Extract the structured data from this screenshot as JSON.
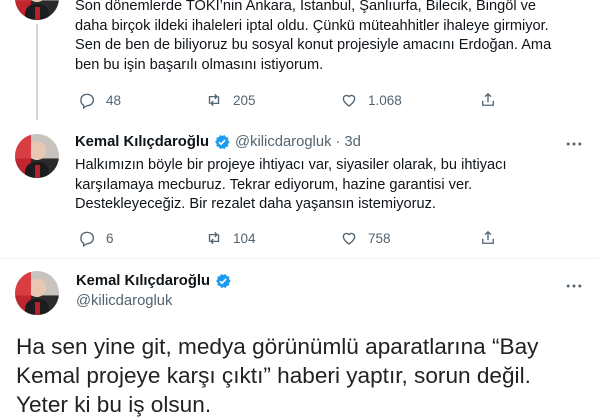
{
  "tweet1": {
    "text_lines": [
      "Son dönemlerde TOKİ’nin Ankara, İstanbul, Şanlıurfa, Bilecik, Bingöl ve",
      "daha birçok ildeki ihaleleri iptal oldu. Çünkü müteahhitler ihaleye girmiyor.",
      "Sen de ben de biliyoruz bu sosyal konut projesiyle amacını Erdoğan. Ama",
      "ben bu işin başarılı olmasını istiyorum."
    ],
    "replies": "48",
    "retweets": "205",
    "likes": "1.068"
  },
  "tweet2": {
    "name": "Kemal Kılıçdaroğlu",
    "handle": "@kilicdarogluk",
    "separator": "·",
    "time": "3d",
    "text_lines": [
      "Halkımızın böyle bir projeye ihtiyacı var, siyasiler olarak, bu ihtiyacı",
      "karşılamaya mecburuz. Tekrar ediyorum, hazine garantisi ver.",
      "Destekleyeceğiz. Bir rezalet daha yaşansın istemiyoruz."
    ],
    "replies": "6",
    "retweets": "104",
    "likes": "758"
  },
  "tweet3": {
    "name": "Kemal Kılıçdaroğlu",
    "handle": "@kilicdarogluk",
    "text_lines": [
      "Ha sen yine git, medya görünümlü aparatlarına “Bay",
      "Kemal projeye karşı çıktı” haberi yaptır, sorun değil.",
      "Yeter ki bu iş olsun."
    ]
  },
  "colors": {
    "text": "#0f1419",
    "secondary": "#536471",
    "verified": "#1d9bf0",
    "thread_line": "#cfd9de"
  },
  "icons": [
    "reply-icon",
    "retweet-icon",
    "like-icon",
    "share-icon",
    "more-icon",
    "verified-badge-icon"
  ]
}
